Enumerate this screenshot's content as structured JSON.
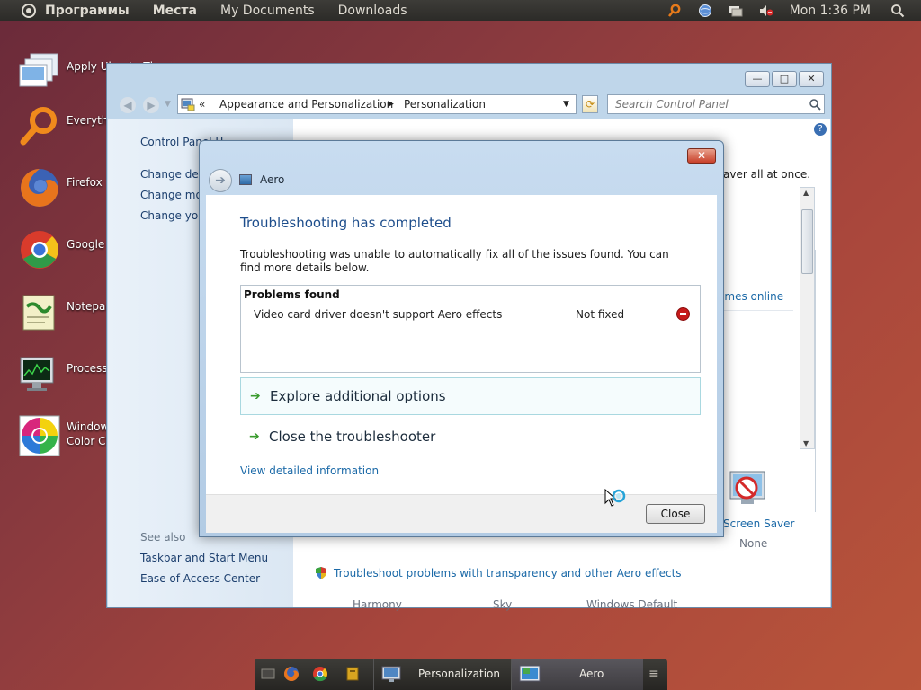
{
  "topbar": {
    "menus": [
      "Программы",
      "Места",
      "My Documents",
      "Downloads"
    ],
    "clock": "Mon 1:36 PM"
  },
  "desktop": {
    "icons": [
      {
        "label": "Apply Ubuntu Theme",
        "icon": "themes-icon"
      },
      {
        "label": "Everythin",
        "icon": "search-magnifier-icon"
      },
      {
        "label": "Firefox",
        "icon": "firefox-icon"
      },
      {
        "label": "Google C",
        "icon": "chrome-icon"
      },
      {
        "label": "Notepac",
        "icon": "notepad-icon"
      },
      {
        "label": "Process",
        "icon": "process-monitor-icon"
      },
      {
        "label": "Window\nColor Ch",
        "icon": "color-wheel-icon"
      }
    ]
  },
  "cpwindow": {
    "breadcrumb": {
      "prefix": "«",
      "items": [
        "Appearance and Personalization",
        "Personalization"
      ]
    },
    "search_placeholder": "Search Control Panel",
    "sidebar": {
      "home": "Control Panel H",
      "links": [
        "Change desk",
        "Change mou",
        "Change you"
      ],
      "see_also_label": "See also",
      "see_also": [
        "Taskbar and Start Menu",
        "Ease of Access Center"
      ]
    },
    "main": {
      "intro_tail": "aver all at once.",
      "themes_online": "emes online",
      "theme_names": [
        "Harmony",
        "Sky",
        "Windows Default"
      ],
      "screen_saver_label": "Screen Saver",
      "screen_saver_value": "None",
      "troubleshoot_link": "Troubleshoot problems with transparency and other Aero effects"
    }
  },
  "dialog": {
    "title": "Aero",
    "heading": "Troubleshooting has completed",
    "description": "Troubleshooting was unable to automatically fix all of the issues found. You can find more details below.",
    "problems_header": "Problems found",
    "problem": {
      "name": "Video card driver doesn't support Aero effects",
      "status": "Not fixed"
    },
    "options": [
      "Explore additional options",
      "Close the troubleshooter"
    ],
    "details_link": "View detailed information",
    "close_button": "Close"
  },
  "taskbar": {
    "tasks": [
      {
        "label": "Personalization",
        "active": false
      },
      {
        "label": "Aero",
        "active": true
      }
    ]
  },
  "colors": {
    "link": "#1c6aa8",
    "heading": "#1e4e8c",
    "panel": "#2c2b28",
    "accent_orange": "#e0731a"
  }
}
